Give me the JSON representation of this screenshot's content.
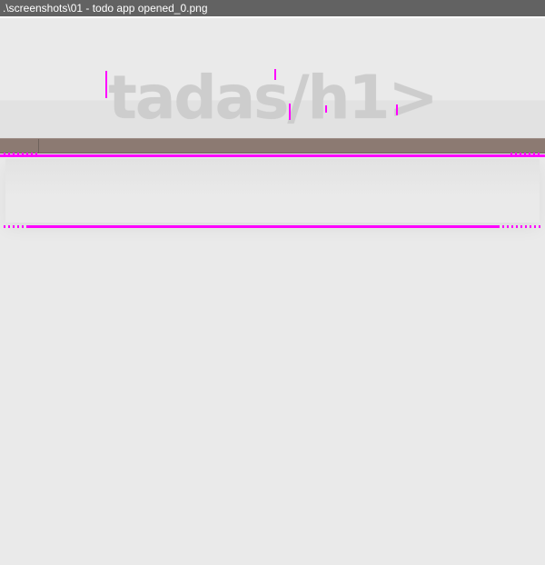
{
  "window": {
    "title": ".\\screenshots\\01 - todo app opened_0.png"
  },
  "app": {
    "heading": "tadas/h1>"
  },
  "colors": {
    "title_bar": "#626262",
    "background": "#eaeaea",
    "heading_text": "#cdcdcd",
    "header_bar": "#8c7a72",
    "artifact_magenta": "#ff00ff"
  }
}
